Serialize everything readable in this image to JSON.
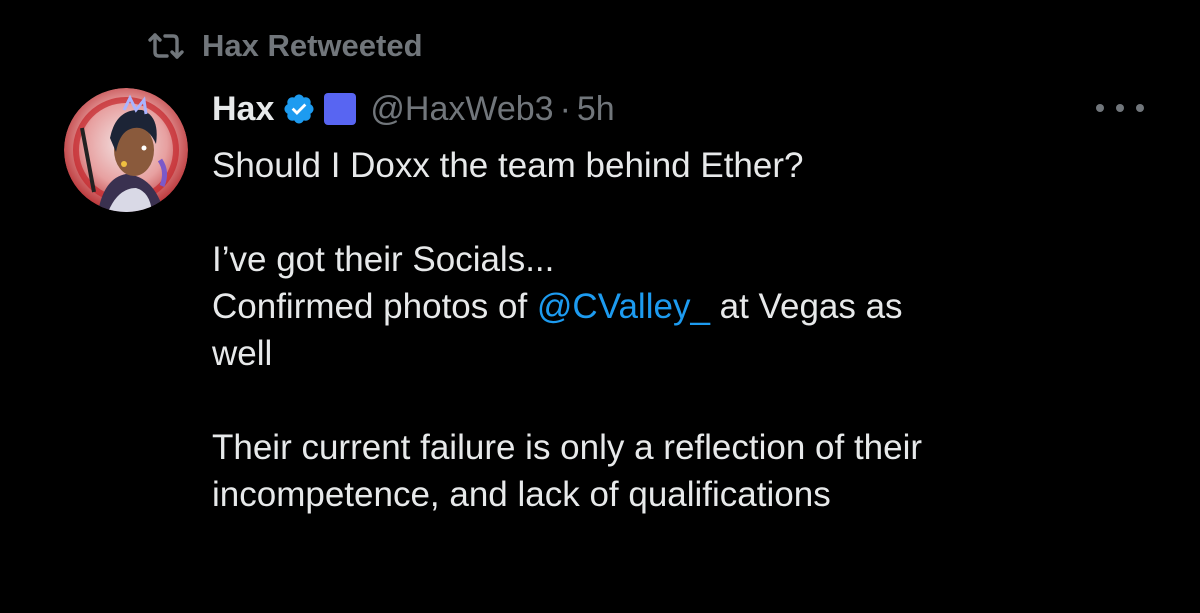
{
  "retweet": {
    "icon": "retweet-icon",
    "label": "Hax Retweeted"
  },
  "author": {
    "avatar_icon": "avatar",
    "display_name": "Hax",
    "verified_icon": "verified-badge-icon",
    "emoji": "blue-square-emoji",
    "handle": "@HaxWeb3",
    "separator": "·",
    "time": "5h"
  },
  "more_icon": "more-options-icon",
  "tweet": {
    "line1": "Should I Doxx the team behind Ether?",
    "line2": "I’ve got their Socials...",
    "line3_prefix": "Confirmed photos of ",
    "line3_mention": "@CValley_",
    "line3_suffix": " at Vegas as",
    "line4": "well",
    "line5": "Their current failure is only a reflection of their",
    "line6": "incompetence, and lack of qualifications"
  },
  "colors": {
    "background": "#000000",
    "text": "#e7e9ea",
    "muted": "#71767b",
    "link": "#1d9bf0",
    "verified": "#1d9bf0",
    "emoji_square": "#5865f2"
  }
}
